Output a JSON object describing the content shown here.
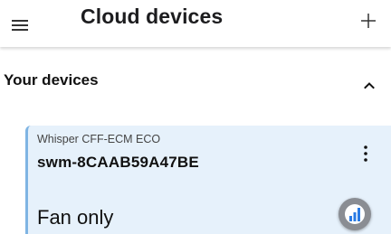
{
  "app_bar": {
    "title": "Cloud devices",
    "menu_icon": "hamburger-menu-icon",
    "add_icon": "plus-icon"
  },
  "section": {
    "title": "Your devices",
    "toggle_icon": "chevron-up-icon"
  },
  "device": {
    "model": "Whisper CFF-ECM ECO",
    "id": "swm-8CAAB59A47BE",
    "mode": "Fan only",
    "menu_icon": "more-vert-icon",
    "status_icon": "signal-bars-icon"
  },
  "colors": {
    "card_background": "#e6f1fb",
    "card_accent": "#7fb4e3",
    "signal_badge": "#8a8d93",
    "signal_bars": "#2a7be4"
  }
}
